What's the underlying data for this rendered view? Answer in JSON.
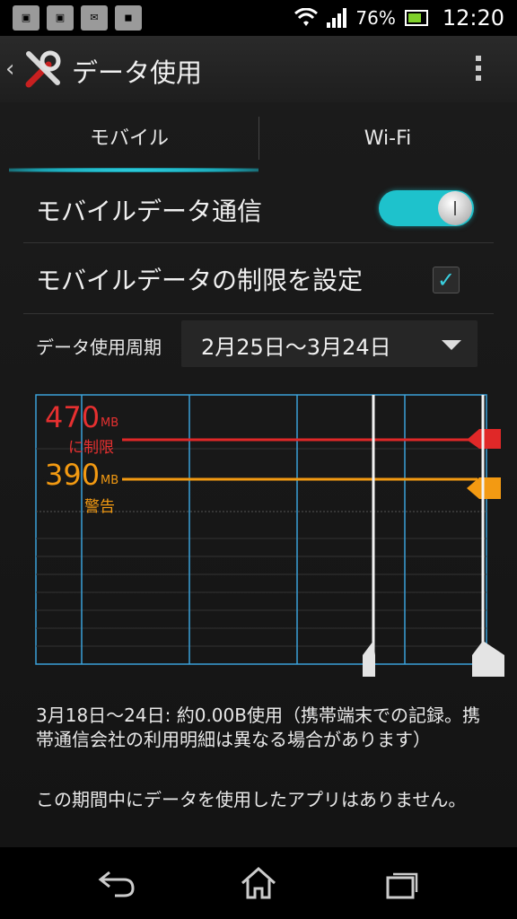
{
  "status_bar": {
    "battery": "76%",
    "time": "12:20"
  },
  "action_bar": {
    "title": "データ使用"
  },
  "tabs": [
    {
      "label": "モバイル"
    },
    {
      "label": "Wi-Fi"
    }
  ],
  "settings": {
    "mobile_data": {
      "label": "モバイルデータ通信",
      "enabled": true
    },
    "limit": {
      "label": "モバイルデータの制限を設定",
      "checked": true
    }
  },
  "cycle": {
    "label": "データ使用周期",
    "value": "2月25日〜3月24日"
  },
  "graph": {
    "limit": {
      "value": "470",
      "unit": "MB",
      "label": "に制限"
    },
    "warning": {
      "value": "390",
      "unit": "MB",
      "label": "警告"
    },
    "colors": {
      "limit": "#e02828",
      "warning": "#f39a12",
      "grid": "#3aa0d8"
    }
  },
  "summary": "3月18日〜24日: 約0.00B使用（携帯端末での記録。携帯通信会社の利用明細は異なる場合があります）",
  "no_apps": "この期間中にデータを使用したアプリはありません。"
}
